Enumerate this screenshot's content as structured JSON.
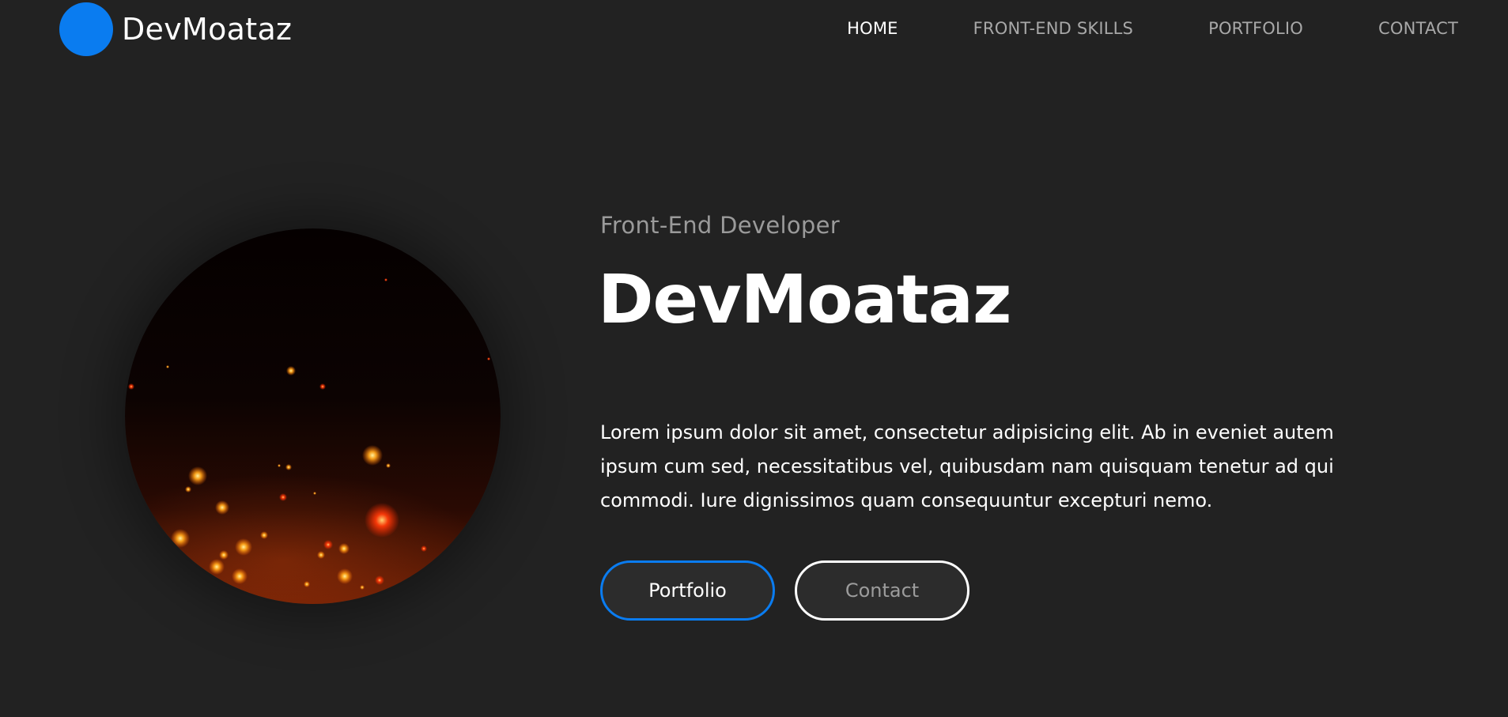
{
  "header": {
    "brand_name": "DevMoataz",
    "brand_color": "#0a7cf0",
    "nav": [
      {
        "label": "HOME",
        "active": true
      },
      {
        "label": "FRONT-END SKILLS",
        "active": false
      },
      {
        "label": "PORTFOLIO",
        "active": false
      },
      {
        "label": "CONTACT",
        "active": false
      }
    ]
  },
  "hero": {
    "image_icon": "ember-sparks-image",
    "subtitle": "Front-End Developer",
    "title": "DevMoataz",
    "description": "Lorem ipsum dolor sit amet, consectetur adipisicing elit. Ab in eveniet autem ipsum cum sed, necessitatibus vel, quibusdam nam quisquam tenetur ad qui commodi. Iure dignissimos quam consequuntur excepturi nemo.",
    "buttons": {
      "portfolio_label": "Portfolio",
      "contact_label": "Contact"
    }
  },
  "colors": {
    "background": "#222222",
    "accent": "#0a7cf0",
    "text": "#ffffff",
    "muted_text": "#9a9a9a"
  }
}
